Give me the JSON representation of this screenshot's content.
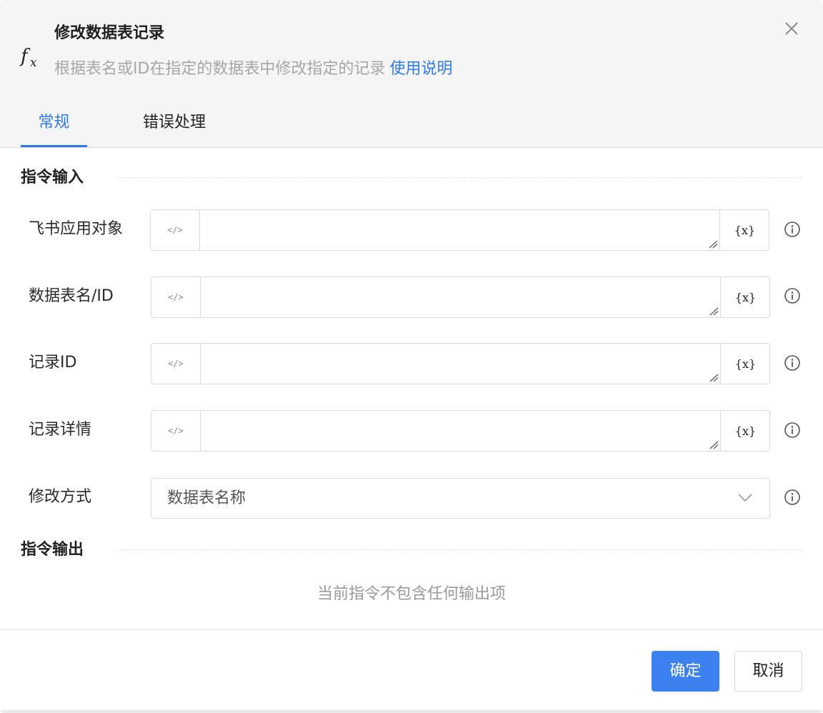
{
  "dialog": {
    "title": "修改数据表记录",
    "subtitle": "根据表名或ID在指定的数据表中修改指定的记录",
    "help_link": "使用说明",
    "icon": "fx-icon",
    "close_icon": "close-icon"
  },
  "tabs": [
    {
      "label": "常规",
      "active": true
    },
    {
      "label": "错误处理",
      "active": false
    }
  ],
  "sections": {
    "input_title": "指令输入",
    "output_title": "指令输出",
    "output_empty": "当前指令不包含任何输出项"
  },
  "fields": [
    {
      "label": "飞书应用对象",
      "value": "",
      "code_icon": "</>",
      "var_icon": "{x}"
    },
    {
      "label": "数据表名/ID",
      "value": "",
      "code_icon": "</>",
      "var_icon": "{x}"
    },
    {
      "label": "记录ID",
      "value": "",
      "code_icon": "</>",
      "var_icon": "{x}"
    },
    {
      "label": "记录详情",
      "value": "",
      "code_icon": "</>",
      "var_icon": "{x}"
    }
  ],
  "modify_mode": {
    "label": "修改方式",
    "value": "数据表名称"
  },
  "buttons": {
    "confirm": "确定",
    "cancel": "取消"
  },
  "colors": {
    "accent": "#2f7bea",
    "primary_button": "#3b82f0",
    "header_bg": "#f5f5f5"
  }
}
